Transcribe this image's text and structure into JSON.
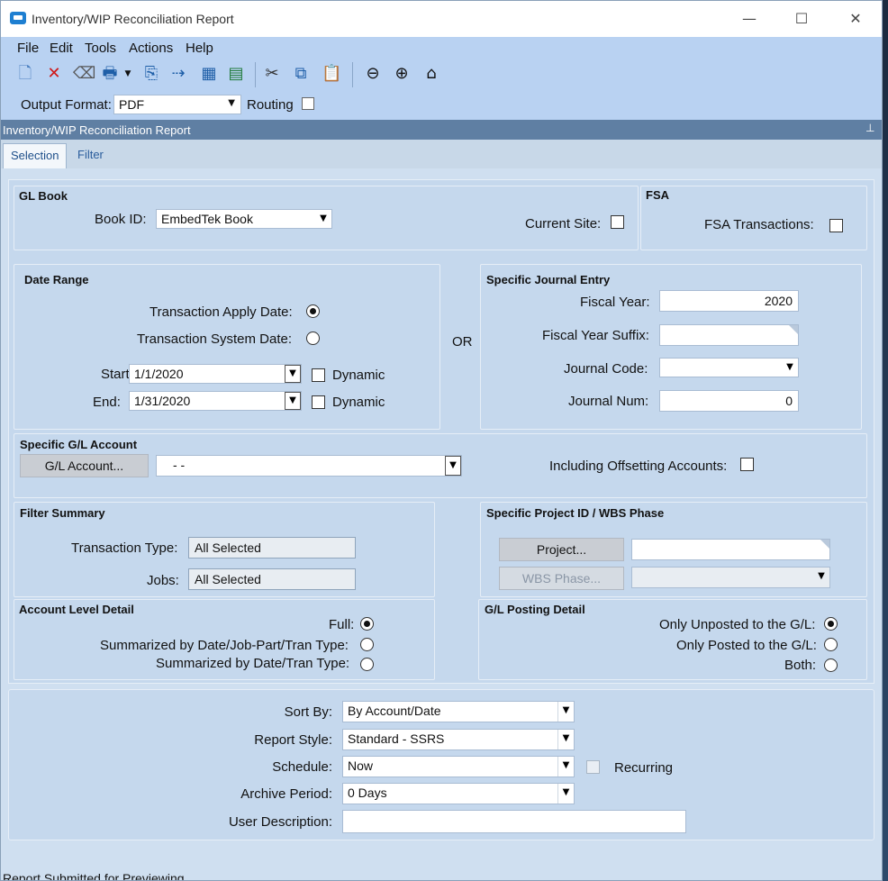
{
  "window": {
    "title": "Inventory/WIP Reconciliation Report",
    "minimize": "—",
    "maximize": "☐",
    "close": "✕"
  },
  "menu": [
    "File",
    "Edit",
    "Tools",
    "Actions",
    "Help"
  ],
  "toolbar": {
    "icons": [
      "new-icon",
      "delete-icon",
      "clear-icon",
      "print-icon",
      "preview-icon",
      "send-icon",
      "export-icon",
      "excel-icon",
      "cut-icon",
      "copy-icon",
      "paste-icon",
      "back-icon",
      "forward-icon",
      "home-icon"
    ]
  },
  "output": {
    "label": "Output Format:",
    "value": "PDF",
    "routing_label": "Routing"
  },
  "panel": {
    "title": "Inventory/WIP Reconciliation Report",
    "pin": "𝟜"
  },
  "tabs": {
    "selection": "Selection",
    "filter": "Filter"
  },
  "gl_book": {
    "title": "GL Book",
    "book_label": "Book ID:",
    "book_value": "EmbedTek Book",
    "current_site_label": "Current Site:"
  },
  "fsa": {
    "title": "FSA",
    "label": "FSA Transactions:"
  },
  "date_range": {
    "title": "Date Range",
    "apply_label": "Transaction Apply Date:",
    "system_label": "Transaction System Date:",
    "start_label": "Start:",
    "start_value": "1/1/2020",
    "end_label": "End:",
    "end_value": "1/31/2020",
    "dynamic_label": "Dynamic"
  },
  "or_label": "OR",
  "journal": {
    "title": "Specific Journal Entry",
    "fy_label": "Fiscal Year:",
    "fy_value": "2020",
    "fys_label": "Fiscal Year Suffix:",
    "jc_label": "Journal Code:",
    "jn_label": "Journal Num:",
    "jn_value": "0"
  },
  "gl_account": {
    "title": "Specific G/L Account",
    "button": "G/L Account...",
    "value": "-          -",
    "offset_label": "Including Offsetting Accounts:"
  },
  "filter_summary": {
    "title": "Filter Summary",
    "tt_label": "Transaction Type:",
    "tt_value": "All Selected",
    "jobs_label": "Jobs:",
    "jobs_value": "All Selected"
  },
  "project": {
    "title": "Specific Project ID / WBS Phase",
    "project_button": "Project...",
    "wbs_button": "WBS Phase..."
  },
  "account_level": {
    "title": "Account Level Detail",
    "full": "Full:",
    "sum1": "Summarized by Date/Job-Part/Tran Type:",
    "sum2": "Summarized by Date/Tran Type:"
  },
  "posting": {
    "title": "G/L Posting Detail",
    "unposted": "Only Unposted to the G/L:",
    "posted": "Only Posted to the G/L:",
    "both": "Both:"
  },
  "report": {
    "sort_label": "Sort By:",
    "sort_value": "By Account/Date",
    "style_label": "Report Style:",
    "style_value": "Standard - SSRS",
    "schedule_label": "Schedule:",
    "schedule_value": "Now",
    "recurring_label": "Recurring",
    "archive_label": "Archive Period:",
    "archive_value": "0 Days",
    "desc_label": "User Description:"
  },
  "status": "Report Submitted for Previewing"
}
